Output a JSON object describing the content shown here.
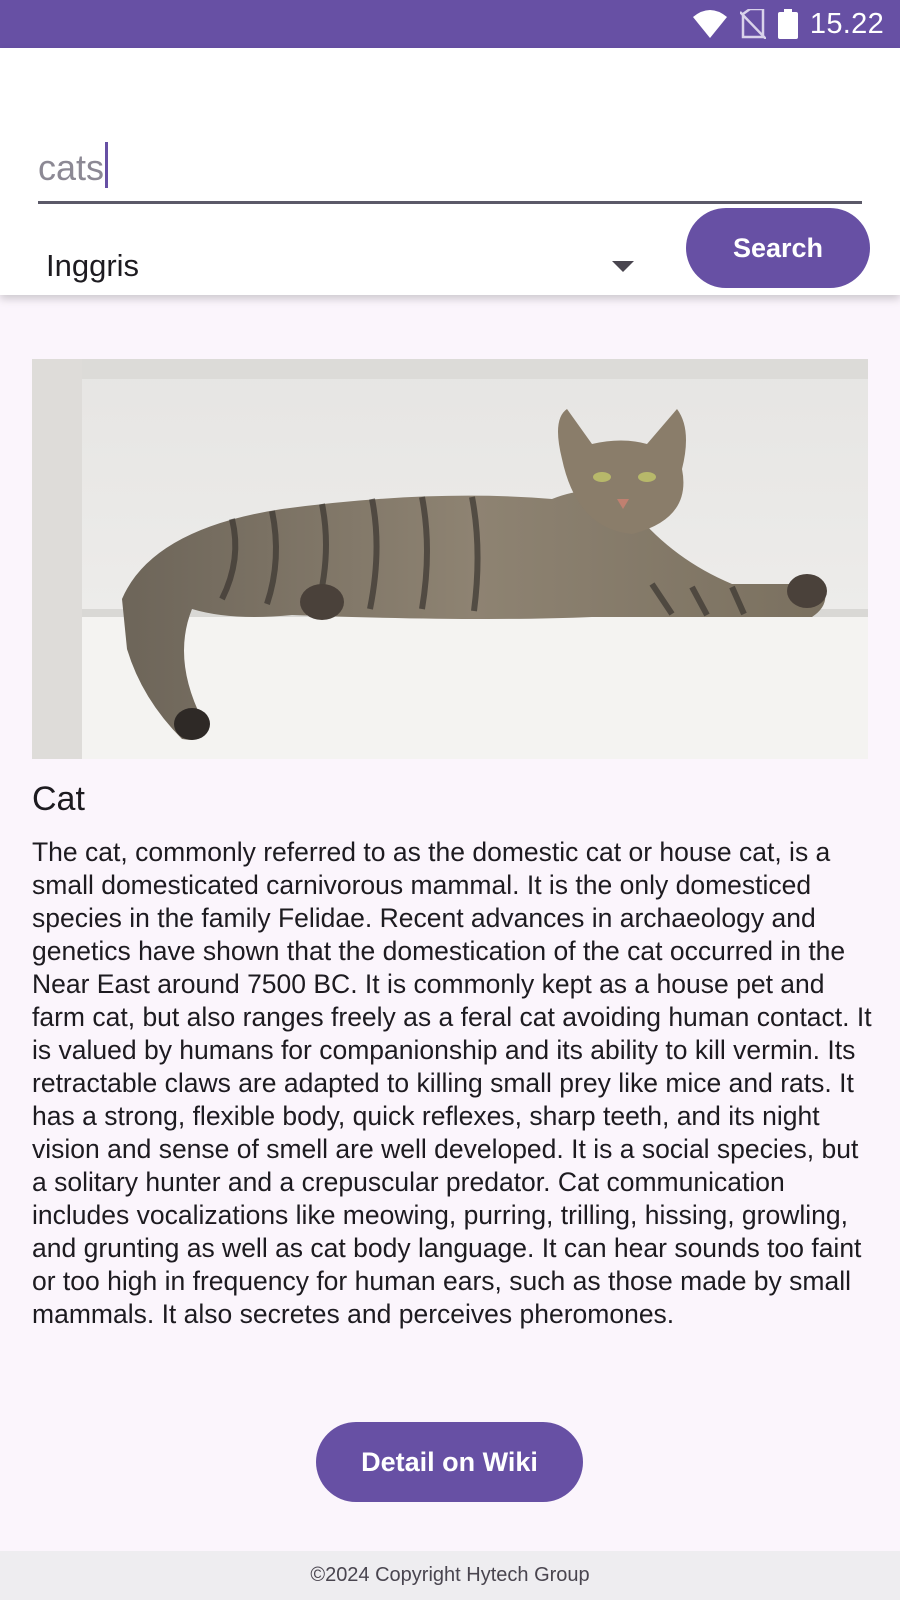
{
  "status_bar": {
    "time": "15.22",
    "icons": [
      "wifi-icon",
      "no-sim-icon",
      "battery-icon"
    ],
    "background": "#6750a4"
  },
  "search": {
    "value": "cats"
  },
  "language_select": {
    "selected": "Inggris"
  },
  "buttons": {
    "search_label": "Search",
    "wiki_label": "Detail on Wiki"
  },
  "article": {
    "title": "Cat",
    "body": "The cat, commonly referred to as the domestic cat or house cat, is a small domesticated carnivorous mammal. It is the only domesticed species in the family Felidae. Recent advances in archaeology and genetics have shown that the domestication of the cat occurred in the Near East around 7500 BC. It is commonly kept as a house pet and farm cat, but also ranges freely as a feral cat avoiding human contact. It is valued by humans for companionship and its ability to kill vermin. Its retractable claws are adapted to killing small prey like mice and rats. It has a strong, flexible body, quick reflexes, sharp teeth, and its night vision and sense of smell are well developed. It is a social species, but a solitary hunter and a crepuscular predator. Cat communication includes vocalizations like meowing, purring, trilling, hissing, growling, and grunting as well as cat body language. It can hear sounds too faint or too high in frequency for human ears, such as those made by small mammals. It also secretes and perceives pheromones."
  },
  "footer": {
    "text": "©2024 Copyright Hytech Group"
  },
  "colors": {
    "accent": "#6750a4",
    "page_background": "#fbf5fc",
    "footer_background": "#eeedf0"
  }
}
